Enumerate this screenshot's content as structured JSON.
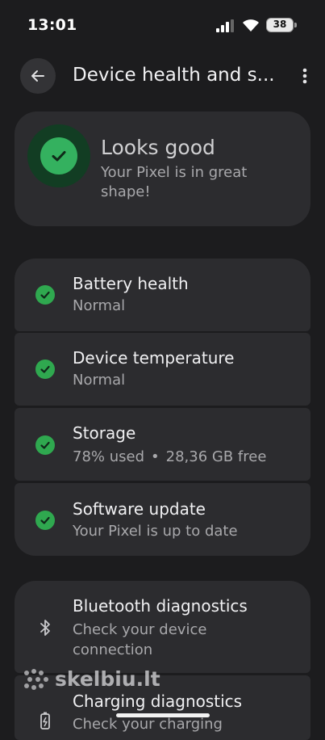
{
  "status_bar": {
    "time": "13:01",
    "battery": "38"
  },
  "header": {
    "title": "Device health and s..."
  },
  "summary": {
    "title": "Looks good",
    "subtitle": "Your Pixel is in great shape!"
  },
  "health_items": [
    {
      "title": "Battery health",
      "subtitle": "Normal"
    },
    {
      "title": "Device temperature",
      "subtitle": "Normal"
    },
    {
      "title": "Storage",
      "used": "78% used",
      "free": "28,36 GB free"
    },
    {
      "title": "Software update",
      "subtitle": "Your Pixel is up to date"
    }
  ],
  "diagnostics": [
    {
      "title": "Bluetooth diagnostics",
      "subtitle": "Check your device connection",
      "icon": "bluetooth-icon"
    },
    {
      "title": "Charging diagnostics",
      "subtitle": "Check your charging",
      "icon": "battery-charging-icon"
    }
  ],
  "watermark": "skelbiu.lt",
  "colors": {
    "check": "#2fa84f",
    "ring": "#123d23",
    "card": "#2c2c2f",
    "background": "#1c1c1e"
  }
}
